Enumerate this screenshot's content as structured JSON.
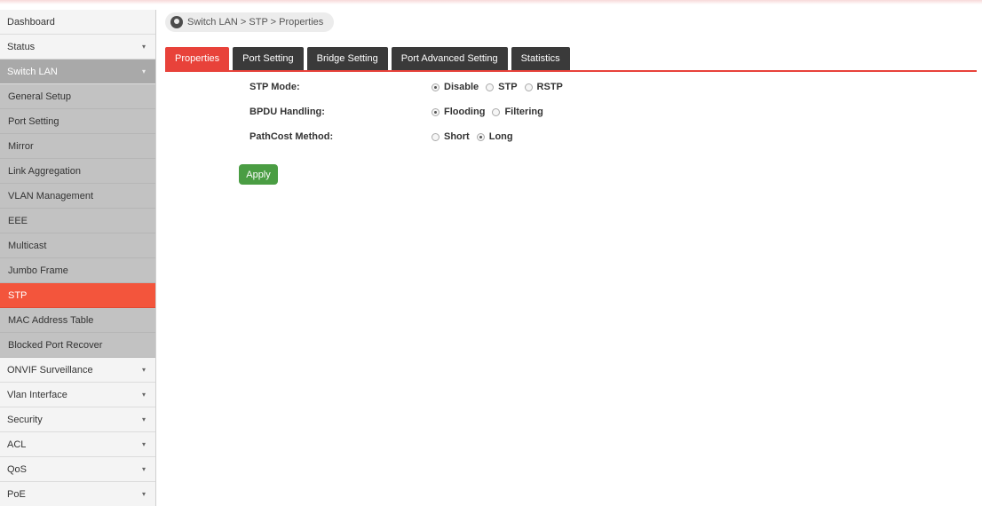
{
  "sidebar": {
    "top_items": [
      {
        "label": "Dashboard",
        "chevron": false
      },
      {
        "label": "Status",
        "chevron": true
      }
    ],
    "open_section": {
      "label": "Switch LAN",
      "sub_items": [
        {
          "label": "General Setup"
        },
        {
          "label": "Port Setting"
        },
        {
          "label": "Mirror"
        },
        {
          "label": "Link Aggregation"
        },
        {
          "label": "VLAN Management"
        },
        {
          "label": "EEE"
        },
        {
          "label": "Multicast"
        },
        {
          "label": "Jumbo Frame"
        },
        {
          "label": "STP"
        },
        {
          "label": "MAC Address Table"
        },
        {
          "label": "Blocked Port Recover"
        }
      ],
      "active_index": 8
    },
    "bottom_items": [
      {
        "label": "ONVIF Surveillance"
      },
      {
        "label": "Vlan Interface"
      },
      {
        "label": "Security"
      },
      {
        "label": "ACL"
      },
      {
        "label": "QoS"
      },
      {
        "label": "PoE"
      }
    ]
  },
  "breadcrumb": {
    "text": "Switch LAN > STP > Properties",
    "icon": "location-pin-icon"
  },
  "tabs": [
    {
      "label": "Properties",
      "active": true
    },
    {
      "label": "Port Setting",
      "active": false
    },
    {
      "label": "Bridge Setting",
      "active": false
    },
    {
      "label": "Port Advanced Setting",
      "active": false
    },
    {
      "label": "Statistics",
      "active": false
    }
  ],
  "form": {
    "stp_mode": {
      "label": "STP Mode:",
      "options": [
        "Disable",
        "STP",
        "RSTP"
      ],
      "selected": "Disable"
    },
    "bpdu_handling": {
      "label": "BPDU Handling:",
      "options": [
        "Flooding",
        "Filtering"
      ],
      "selected": "Flooding"
    },
    "pathcost_method": {
      "label": "PathCost Method:",
      "options": [
        "Short",
        "Long"
      ],
      "selected": "Long"
    }
  },
  "apply_label": "Apply",
  "colors": {
    "accent": "#e8423a",
    "active_menu": "#f3553c",
    "apply": "#4a9d43",
    "tab_dark": "#3a3a3a"
  }
}
